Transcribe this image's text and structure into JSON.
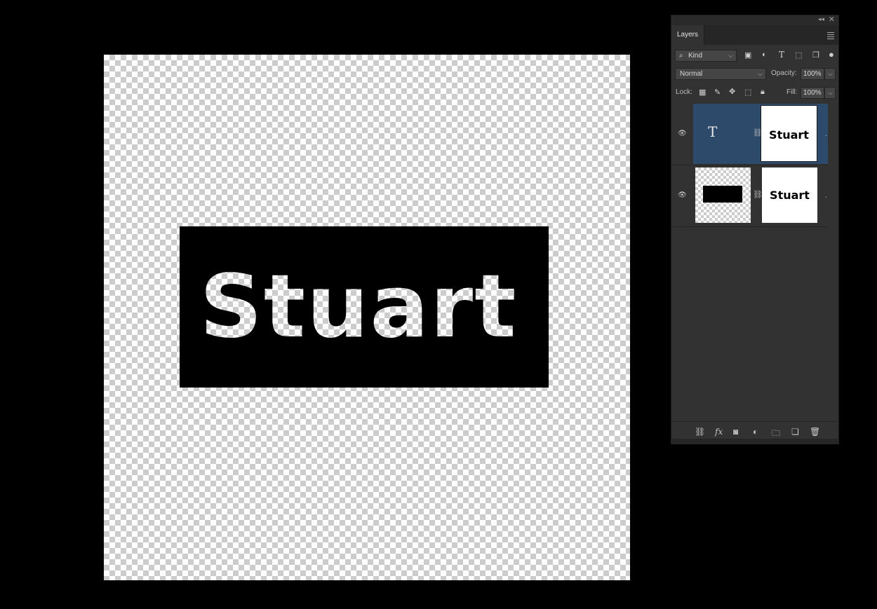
{
  "canvas": {
    "text": "Stuart"
  },
  "panel": {
    "tab": "Layers",
    "filter": {
      "label": "Kind"
    },
    "blend_mode": "Normal",
    "opacity_label": "Opacity:",
    "opacity_value": "100%",
    "lock_label": "Lock:",
    "fill_label": "Fill:",
    "fill_value": "100%",
    "layers": [
      {
        "type": "text",
        "mask_text": "Stuart",
        "selected": true
      },
      {
        "type": "shape",
        "mask_text": "Stuart",
        "selected": false
      }
    ]
  },
  "icons": {
    "search": "search-icon",
    "image_filter": "image-filter-icon",
    "adjustment_filter": "adjustment-filter-icon",
    "type_filter": "type-filter-icon",
    "shape_filter": "shape-filter-icon",
    "smart_object_filter": "smart-object-filter-icon",
    "filter_toggle": "filter-toggle-icon"
  },
  "colors": {
    "selected_layer": "#2e4a6b",
    "panel_bg": "#323232"
  }
}
